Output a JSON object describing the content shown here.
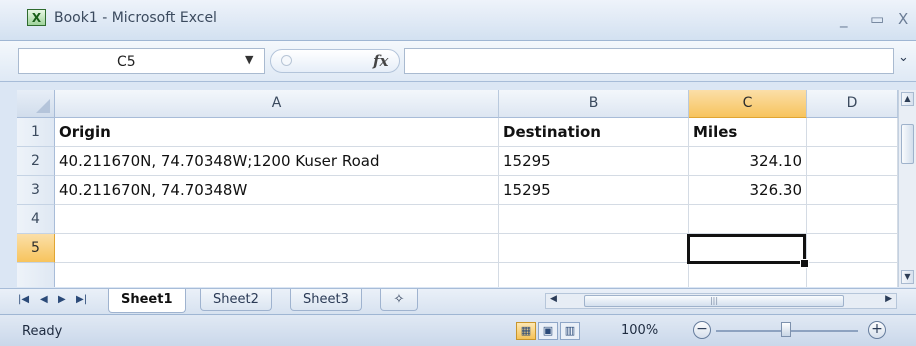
{
  "window": {
    "title": "Book1 - Microsoft Excel",
    "icon": "excel-app-icon"
  },
  "formula_bar": {
    "name_box": "C5",
    "fx_label": "fx",
    "formula": ""
  },
  "columns": [
    {
      "label": "A",
      "selected": false
    },
    {
      "label": "B",
      "selected": false
    },
    {
      "label": "C",
      "selected": true
    },
    {
      "label": "D",
      "selected": false
    }
  ],
  "rows": [
    {
      "num": "1",
      "A": "Origin",
      "B": "Destination",
      "C": "Miles",
      "D": ""
    },
    {
      "num": "2",
      "A": "40.211670N, 74.70348W;1200 Kuser Road",
      "B": "15295",
      "C": "324.10",
      "D": ""
    },
    {
      "num": "3",
      "A": "40.211670N, 74.70348W",
      "B": "15295",
      "C": "326.30",
      "D": ""
    },
    {
      "num": "4",
      "A": "",
      "B": "",
      "C": "",
      "D": ""
    },
    {
      "num": "5",
      "A": "",
      "B": "",
      "C": "",
      "D": ""
    }
  ],
  "sheet_tabs": [
    {
      "label": "Sheet1",
      "active": true
    },
    {
      "label": "Sheet2",
      "active": false
    },
    {
      "label": "Sheet3",
      "active": false
    }
  ],
  "status": {
    "text": "Ready",
    "zoom": "100%"
  },
  "colors": {
    "selection_header": "#f7c45d",
    "chrome": "#dbe6f4"
  }
}
